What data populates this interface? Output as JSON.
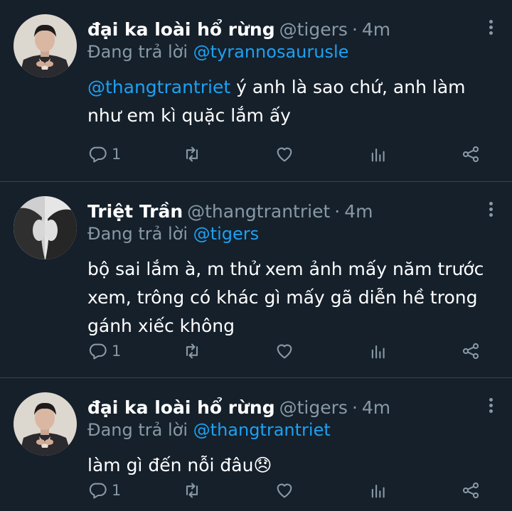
{
  "tweets": [
    {
      "display_name": "đại ka loài hổ rừng",
      "handle": "@tigers",
      "separator": "·",
      "time": "4m",
      "reply_prefix": "Đang trả lời",
      "reply_to": "@tyrannosaurusle",
      "body_mention": "@thangtrantriet",
      "body_text": " ý anh là sao chứ, anh làm như em kì quặc lắm ấy",
      "reply_count": "1"
    },
    {
      "display_name": "Triệt Trần",
      "handle": "@thangtrantriet",
      "separator": "·",
      "time": "4m",
      "reply_prefix": "Đang trả lời",
      "reply_to": "@tigers",
      "body_mention": "",
      "body_text": "bộ sai lắm à, m thử xem ảnh mấy năm trước xem, trông có khác gì mấy gã diễn hề trong gánh xiếc không",
      "reply_count": "1"
    },
    {
      "display_name": "đại ka loài hổ rừng",
      "handle": "@tigers",
      "separator": "·",
      "time": "4m",
      "reply_prefix": "Đang trả lời",
      "reply_to": "@thangtrantriet",
      "body_mention": "",
      "body_text": "làm gì đến nỗi đâu😞",
      "reply_count": "1"
    }
  ],
  "icons": [
    "reply-icon",
    "retweet-icon",
    "like-icon",
    "analytics-icon",
    "share-icon",
    "more-icon"
  ],
  "colors": {
    "background": "#15202b",
    "accent": "#1da1f2",
    "muted": "#8899a6",
    "divider": "#38444d"
  }
}
